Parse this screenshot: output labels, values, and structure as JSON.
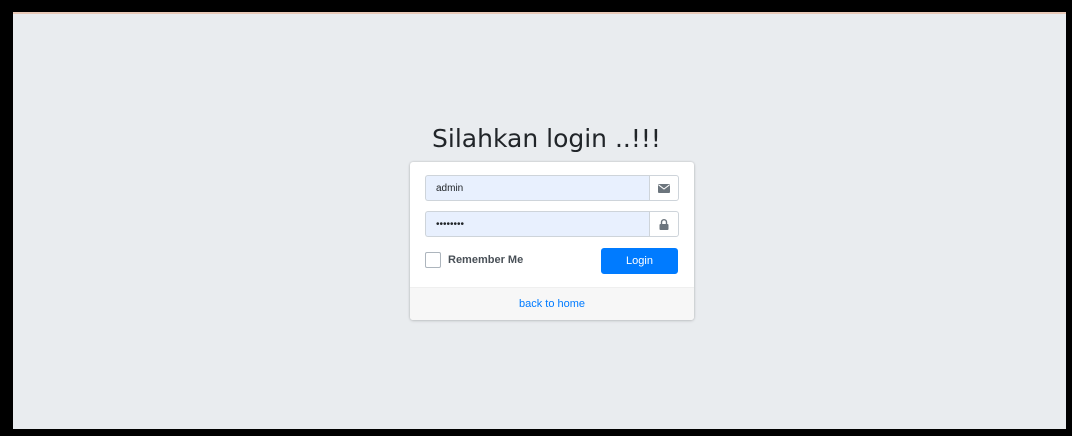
{
  "login": {
    "heading": "Silahkan login ..!!!",
    "username": {
      "value": "admin",
      "icon": "envelope-icon"
    },
    "password": {
      "value": "admin123",
      "icon": "lock-icon"
    },
    "remember_label": "Remember Me",
    "remember_checked": false,
    "login_button": "Login",
    "back_link": "back to home"
  },
  "colors": {
    "background": "#e9ecef",
    "primary": "#007bff",
    "input_fill": "#e8f0fe"
  }
}
